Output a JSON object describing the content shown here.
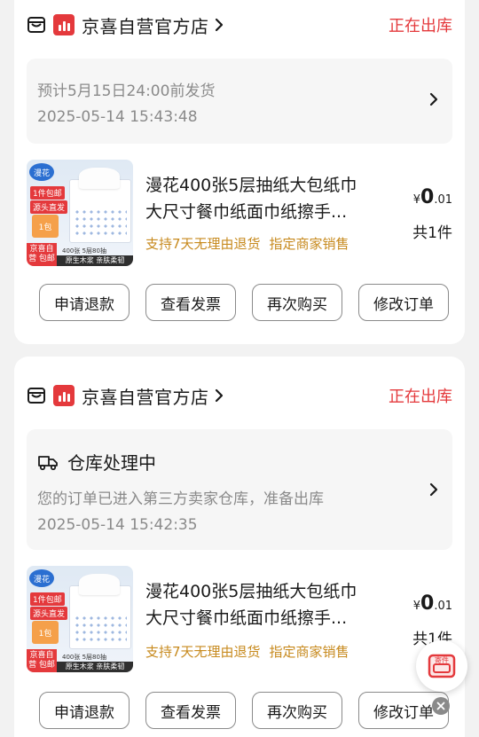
{
  "colors": {
    "accent": "#e4393c",
    "tag": "#c78a1e"
  },
  "orders": [
    {
      "shop_name": "京喜自营官方店",
      "status": "正在出库",
      "ship_estimate": "预计5月15日24:00前发货",
      "timestamp": "2025-05-14 15:43:48",
      "product": {
        "title_line1": "漫花400张5层抽纸大包纸巾",
        "title_line2": "大尺寸餐巾纸面巾纸擦手...",
        "tag1": "支持7天无理由退货",
        "tag2": "指定商家销售",
        "price_yen": "¥",
        "price_int": "0",
        "price_dec": ".01",
        "qty": "共1件",
        "thumb": {
          "logo": "漫花",
          "tag1": "1件包邮",
          "tag2": "源头直发",
          "promo": "1包",
          "red": "京喜自营 包邮",
          "dark": "原生木浆 亲肤柔韧",
          "small": "400张 5层80抽"
        }
      },
      "buttons": [
        "申请退款",
        "查看发票",
        "再次购买",
        "修改订单"
      ]
    },
    {
      "shop_name": "京喜自营官方店",
      "status": "正在出库",
      "warehouse_title": "仓库处理中",
      "warehouse_desc": "您的订单已进入第三方卖家仓库，准备出库",
      "timestamp": "2025-05-14 15:42:35",
      "product": {
        "title_line1": "漫花400张5层抽纸大包纸巾",
        "title_line2": "大尺寸餐巾纸面巾纸擦手...",
        "tag1": "支持7天无理由退货",
        "tag2": "指定商家销售",
        "price_yen": "¥",
        "price_int": "0",
        "price_dec": ".01",
        "qty": "共1件",
        "thumb": {
          "logo": "漫花",
          "tag1": "1件包邮",
          "tag2": "源头直发",
          "promo": "1包",
          "red": "京喜自营 包邮",
          "dark": "原生木浆 亲肤柔韧",
          "small": "400张 5层80抽"
        }
      },
      "buttons": [
        "申请退款",
        "查看发票",
        "再次购买",
        "修改订单"
      ]
    }
  ],
  "float": {
    "label": "寄件"
  }
}
